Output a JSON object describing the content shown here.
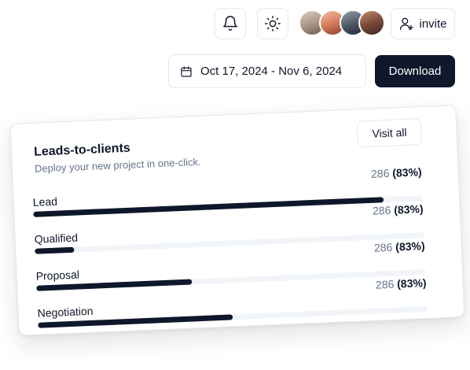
{
  "header": {
    "invite_label": "invite",
    "avatars": [
      {
        "name": "avatar-1",
        "color": "#c9b8a6"
      },
      {
        "name": "avatar-2",
        "color": "#d98b6a"
      },
      {
        "name": "avatar-3",
        "color": "#4b5563"
      },
      {
        "name": "avatar-4",
        "color": "#7c4a3a"
      }
    ]
  },
  "toolbar": {
    "date_range": "Oct 17, 2024 - Nov 6, 2024",
    "download_label": "Download"
  },
  "card": {
    "title": "Leads-to-clients",
    "subtitle": "Deploy your new project in one-click.",
    "visit_all_label": "Visit all",
    "rows": [
      {
        "label": "Lead",
        "count": "286",
        "percent": "(83%)",
        "fill": 0.9
      },
      {
        "label": "Qualified",
        "count": "286",
        "percent": "(83%)",
        "fill": 0.1
      },
      {
        "label": "Proposal",
        "count": "286",
        "percent": "(83%)",
        "fill": 0.4
      },
      {
        "label": "Negotiation",
        "count": "286",
        "percent": "(83%)",
        "fill": 0.5
      }
    ]
  },
  "colors": {
    "primary": "#0f172a",
    "muted_text": "#64748b",
    "track": "#f1f5f9",
    "border": "#e2e8f0"
  },
  "icons": [
    "bell-icon",
    "sun-icon",
    "user-plus-icon",
    "calendar-icon"
  ]
}
